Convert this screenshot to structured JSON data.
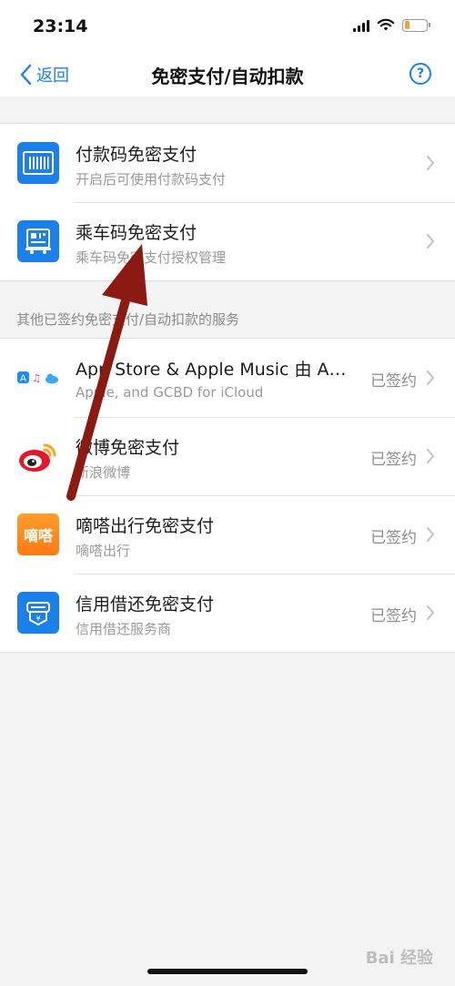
{
  "status_bar": {
    "time": "23:14"
  },
  "nav": {
    "back_label": "返回",
    "title": "免密支付/自动扣款",
    "help_label": "?"
  },
  "group1": [
    {
      "title": "付款码免密支付",
      "subtitle": "开启后可使用付款码支付",
      "icon": "barcode-icon"
    },
    {
      "title": "乘车码免密支付",
      "subtitle": "乘车码免密支付授权管理",
      "icon": "qr-bus-icon"
    }
  ],
  "section_header": "其他已签约免密支付/自动扣款的服务",
  "group2": [
    {
      "title": "App Store & Apple Music 由 Apple, and GCBD for iCloud",
      "subtitle": "Apple, and GCBD for iCloud",
      "status": "已签约",
      "icon": "app-store-icon"
    },
    {
      "title": "微博免密支付",
      "subtitle": "新浪微博",
      "status": "已签约",
      "icon": "weibo-icon"
    },
    {
      "title": "嘀嗒出行免密支付",
      "subtitle": "嘀嗒出行",
      "status": "已签约",
      "icon": "dida-icon",
      "icon_text": "嘀嗒"
    },
    {
      "title": "信用借还免密支付",
      "subtitle": "信用借还服务商",
      "status": "已签约",
      "icon": "credit-lend-icon"
    }
  ],
  "watermark": "Bai 经验",
  "colors": {
    "accent": "#1c7ff1",
    "arrow": "#8b1a12",
    "orange": "#ff8a1f"
  }
}
